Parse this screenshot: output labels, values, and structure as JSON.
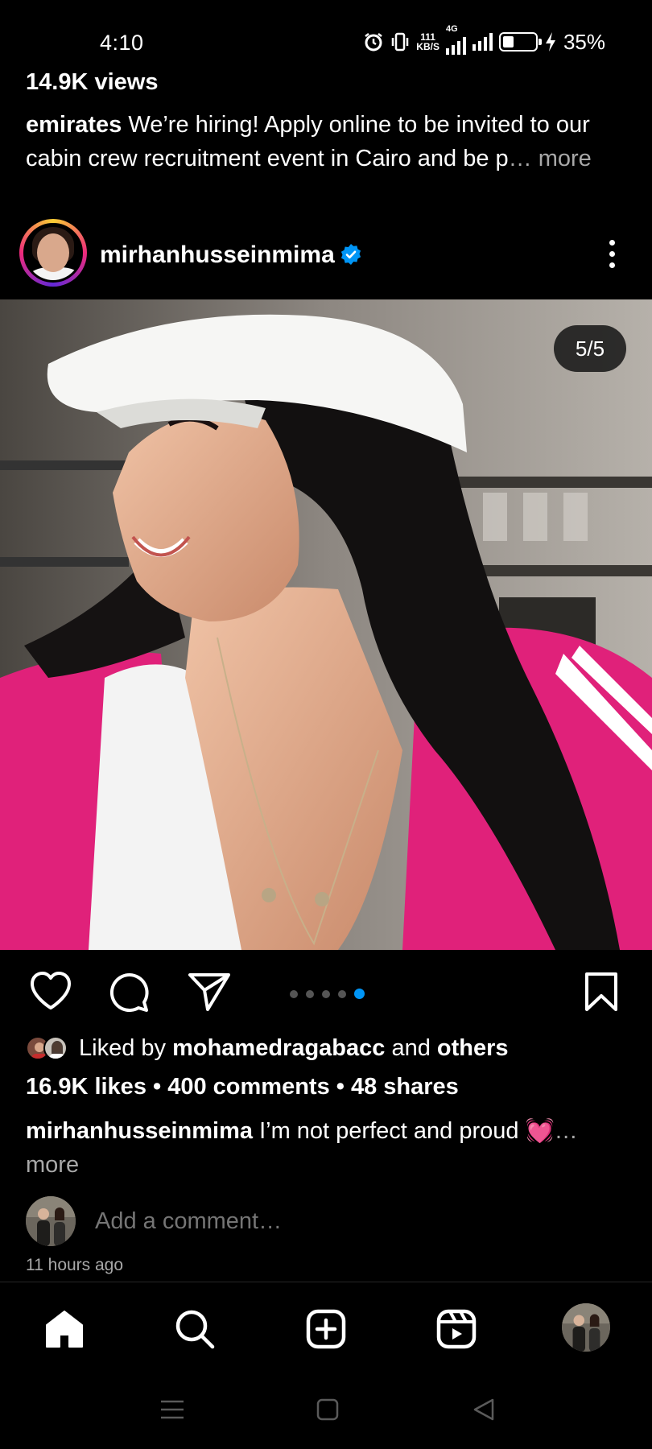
{
  "status_bar": {
    "time": "4:10",
    "net_rate_value": "111",
    "net_rate_unit": "KB/S",
    "network_type": "4G",
    "battery": "35%"
  },
  "previous_post": {
    "views": "14.9K views",
    "username": "emirates",
    "caption": " We’re hiring! Apply online to be invited to our cabin crew recruitment event in Cairo and be p",
    "ellipsis": "… ",
    "more": "more"
  },
  "post": {
    "author": "mirhanhusseinmima",
    "slide_counter": "5/5",
    "carousel_total": 5,
    "carousel_active": 5,
    "liked_by_prefix": "Liked by ",
    "liked_by_user": "mohamedragabacc",
    "liked_by_and": " and ",
    "liked_by_others": "others",
    "stats": "16.9K likes • 400 comments • 48 shares",
    "caption_username": "mirhanhusseinmima",
    "caption_text": " I’m not perfect and proud ",
    "caption_emoji": "💓",
    "caption_ellipsis": "…",
    "caption_more": "more",
    "comment_placeholder": "Add a comment…",
    "timestamp": "11 hours ago"
  },
  "icons": {
    "like": "heart-icon",
    "comment": "comment-icon",
    "share": "send-icon",
    "save": "bookmark-icon",
    "verified": "verified-badge-icon",
    "more": "more-vertical-icon"
  },
  "bottom_nav": [
    "home",
    "search",
    "create",
    "reels",
    "profile"
  ],
  "colors": {
    "background": "#000000",
    "accent_blue": "#0095f6",
    "muted_text": "#a8a8a8"
  }
}
